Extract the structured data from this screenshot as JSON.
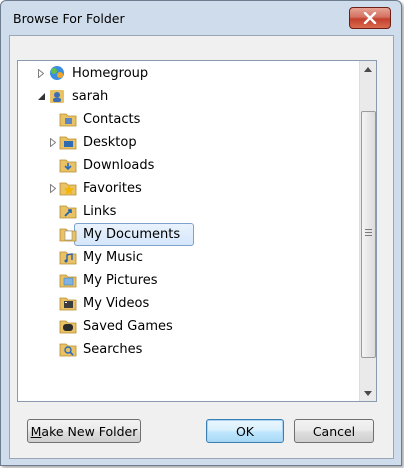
{
  "window": {
    "title": "Browse For Folder"
  },
  "tree": {
    "items": [
      {
        "label": "Homegroup",
        "icon": "homegroup-icon",
        "expander": "collapsed"
      },
      {
        "label": "sarah",
        "icon": "user-folder-icon",
        "expander": "expanded"
      },
      {
        "label": "Contacts",
        "icon": "contacts-folder-icon",
        "expander": "none"
      },
      {
        "label": "Desktop",
        "icon": "desktop-folder-icon",
        "expander": "collapsed"
      },
      {
        "label": "Downloads",
        "icon": "downloads-folder-icon",
        "expander": "none"
      },
      {
        "label": "Favorites",
        "icon": "favorites-folder-icon",
        "expander": "collapsed"
      },
      {
        "label": "Links",
        "icon": "links-folder-icon",
        "expander": "none"
      },
      {
        "label": "My Documents",
        "icon": "documents-folder-icon",
        "expander": "none",
        "selected": true
      },
      {
        "label": "My Music",
        "icon": "music-folder-icon",
        "expander": "none"
      },
      {
        "label": "My Pictures",
        "icon": "pictures-folder-icon",
        "expander": "none"
      },
      {
        "label": "My Videos",
        "icon": "videos-folder-icon",
        "expander": "none"
      },
      {
        "label": "Saved Games",
        "icon": "saved-games-folder-icon",
        "expander": "none"
      },
      {
        "label": "Searches",
        "icon": "searches-folder-icon",
        "expander": "none"
      }
    ]
  },
  "buttons": {
    "make_new_folder_mnemonic": "M",
    "make_new_folder_rest": "ake New Folder",
    "ok": "OK",
    "cancel": "Cancel"
  },
  "colors": {
    "selection_border": "#7da2ce",
    "default_button_border": "#3c7fb1",
    "close_red": "#c4402d"
  }
}
